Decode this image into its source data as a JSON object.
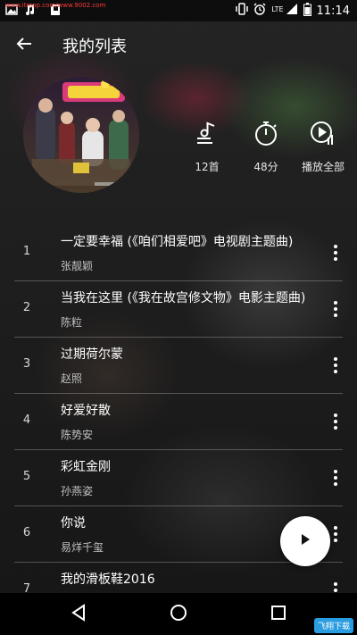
{
  "status_bar": {
    "time": "11:14",
    "network": "LTE",
    "watermark": "www.itmop.com/www.9002.com"
  },
  "app_bar": {
    "title": "我的列表"
  },
  "playlist": {
    "song_count": "12首",
    "duration": "48分",
    "play_all_label": "播放全部"
  },
  "songs": [
    {
      "num": "1",
      "title": "一定要幸福 (《咱们相爱吧》电视剧主题曲)",
      "artist": "张靓颖"
    },
    {
      "num": "2",
      "title": "当我在这里 (《我在故宫修文物》电影主题曲)",
      "artist": "陈粒"
    },
    {
      "num": "3",
      "title": "过期荷尔蒙",
      "artist": "赵照"
    },
    {
      "num": "4",
      "title": "好爱好散",
      "artist": "陈势安"
    },
    {
      "num": "5",
      "title": "彩虹金刚",
      "artist": "孙燕姿"
    },
    {
      "num": "6",
      "title": "你说",
      "artist": "易烊千玺"
    },
    {
      "num": "7",
      "title": "我的滑板鞋2016",
      "artist": ""
    }
  ],
  "bottom_watermark": "飞翔下载",
  "icons": {
    "back": "arrow-back-icon",
    "count": "music-list-icon",
    "duration": "stopwatch-icon",
    "play_all": "play-all-icon",
    "more": "more-vert-icon",
    "fab": "play-icon"
  }
}
